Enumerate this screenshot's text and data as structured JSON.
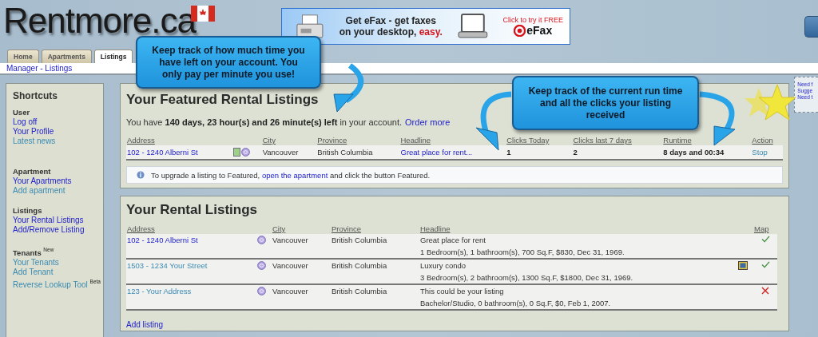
{
  "logo": {
    "text": "Rentmore.ca"
  },
  "ad": {
    "line1": "Get eFax - get faxes",
    "line2": "on your desktop,",
    "accent": "easy.",
    "cta": "Click to try it FREE",
    "brand": "eFax"
  },
  "tabs": [
    {
      "label": "Home",
      "selected": false
    },
    {
      "label": "Apartments",
      "selected": false
    },
    {
      "label": "Listings",
      "selected": true
    }
  ],
  "breadcrumb": "Manager - Listings",
  "sidebar": {
    "title": "Shortcuts",
    "sections": [
      {
        "heading": "User",
        "links": [
          {
            "label": "Log off",
            "visited": false
          },
          {
            "label": "Your Profile",
            "visited": false
          },
          {
            "label": "Latest news",
            "visited": true
          }
        ]
      },
      {
        "heading": "Apartment",
        "links": [
          {
            "label": "Your Apartments",
            "visited": false
          },
          {
            "label": "Add apartment",
            "visited": true
          }
        ]
      },
      {
        "heading": "Listings",
        "links": [
          {
            "label": "Your Rental Listings",
            "visited": false
          },
          {
            "label": "Add/Remove Listing",
            "visited": false
          }
        ]
      },
      {
        "heading": "Tenants $^{New}$",
        "links": [
          {
            "label": "Your Tenants",
            "visited": true
          },
          {
            "label": "Add Tenant",
            "visited": true
          },
          {
            "label": "Reverse Lookup Tool $^{Beta}$",
            "visited": true
          }
        ]
      }
    ]
  },
  "featured": {
    "title": "Your Featured Rental Listings",
    "account": "You have **140 days, 23 hour(s) and 26 minute(s) left** in your account.",
    "order_link": "Order more",
    "columns": [
      "Address",
      "City",
      "Province",
      "Headline",
      "Clicks Today",
      "Clicks last 7 days",
      "Runtime",
      "Action"
    ],
    "rows": [
      {
        "address": "102 - 1240 Alberni St",
        "city": "Vancouver",
        "province": "British Columbia",
        "headline": "Great place for rent...",
        "clicks_today": "1",
        "clicks_7_days": "2",
        "runtime": "8 days and 00:34",
        "action": "Stop"
      }
    ],
    "info": {
      "before": "To upgrade a listing to Featured,",
      "link": "open the apartment",
      "after": "and click the button Featured."
    }
  },
  "rentals": {
    "title": "Your Rental Listings",
    "columns": [
      "Address",
      "City",
      "Province",
      "Headline",
      "Map"
    ],
    "rows": [
      {
        "address": "102 - 1240 Alberni St",
        "visited": false,
        "city": "Vancouver",
        "province": "British Columbia",
        "headline": "Great place for rent",
        "details": "1 Bedroom(s), 1 bathroom(s), 700 Sq.F, $830, Dec 31, 1969.",
        "photo": false,
        "map": true
      },
      {
        "address": "1503 - 1234 Your Street",
        "visited": true,
        "city": "Vancouver",
        "province": "British Columbia",
        "headline": "Luxury condo",
        "details": "3 Bedroom(s), 2 bathroom(s), 1300 Sq.F, $1800, Dec 31, 1969.",
        "photo": true,
        "map": true
      },
      {
        "address": "123 - Your Address",
        "visited": true,
        "city": "Vancouver",
        "province": "British Columbia",
        "headline": "This could be your listing",
        "details": "Bachelor/Studio, 0 bathroom(s), 0 Sq.F, $0, Feb 1, 2007.",
        "photo": false,
        "map": false
      }
    ],
    "add_link": "Add listing"
  },
  "help_box": {
    "lines": [
      "Need f",
      "Sugge",
      "Need t"
    ]
  },
  "callouts": [
    "Keep track of how much time you have left on your account.  You only pay per minute you use!",
    "Keep track of the current run time and all the clicks your listing received"
  ]
}
